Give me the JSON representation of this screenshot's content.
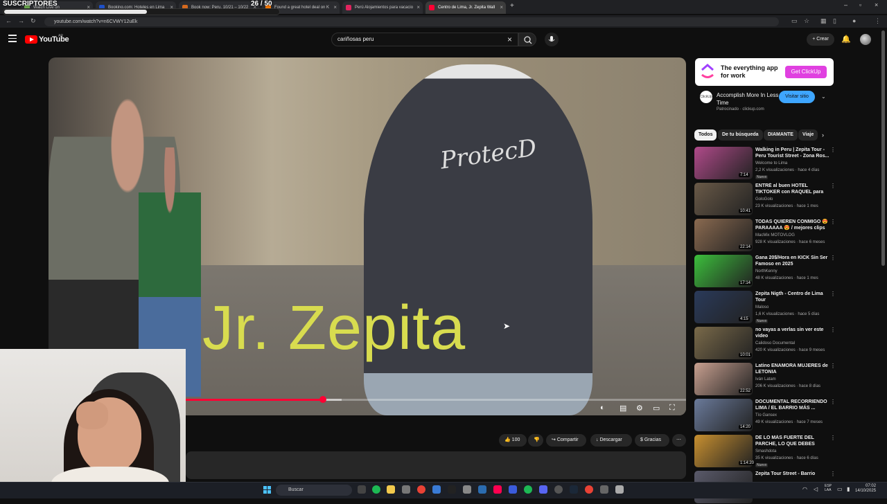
{
  "overlay": {
    "title": "SUSCRIPTORES",
    "count": "26 / 50",
    "progress_fraction": 0.52
  },
  "browser": {
    "tabs": [
      {
        "label": "Watch Live on",
        "color": "#6aa84f"
      },
      {
        "label": "Booking.com: Hoteles en Lima",
        "color": "#1e50c8"
      },
      {
        "label": "Book now: Peru, 10/21 – 10/22",
        "color": "#d4691e"
      },
      {
        "label": "Found a great hotel deal on K",
        "color": "#ff7a00"
      },
      {
        "label": "Perú Alojamientos para vacacio",
        "color": "#e0245e"
      },
      {
        "label": "Centro de Lima, Jr. Zepita Wall",
        "color": "#ff0033"
      }
    ],
    "url": "youtube.com/watch?v=n6CVWY12uEk"
  },
  "youtube": {
    "logo": "YouTube",
    "region": "AR",
    "search_query": "cariñosas peru",
    "create_label": "Crear"
  },
  "video": {
    "overlay_text": "Jr. Zepita",
    "hoodie_text": "ProtecD",
    "progress_fraction": 0.43,
    "buffered_fraction": 0.46
  },
  "actions": {
    "likes": "100",
    "share": "Compartir",
    "download": "Descargar",
    "thanks": "Gracias"
  },
  "ad": {
    "headline": "The everything app for work",
    "cta_banner": "Get ClickUp",
    "icon_label": "ClickUp",
    "title": "Accomplish More In Less Time",
    "sponsor": "Patrocinado · clickup.com",
    "visit": "Visitar sitio"
  },
  "chips": [
    "Todos",
    "De tu búsqueda",
    "DIAMANTE",
    "Viaje"
  ],
  "recommendations": [
    {
      "title": "Walking in Peru | Zepita Tour - Peru Tourist Street - Zona Ros...",
      "channel": "Welcome to Lima",
      "meta": "2,2 K visualizaciones · hace 4 días",
      "badge": "Nuevo",
      "duration": "7:14",
      "color": "#b04a8a"
    },
    {
      "title": "ENTRÉ al buen HOTEL TIKTOKER con RAQUEL para e...",
      "channel": "GoloGolo",
      "meta": "23 K visualizaciones · hace 1 mes",
      "badge": "",
      "duration": "10:41",
      "color": "#6a5a48"
    },
    {
      "title": "TODAS QUIEREN CONMIGO 😍 PARAAAAA 😍 / mejores clips ...",
      "channel": "MacMix MOTOVLOG",
      "meta": "928 K visualizaciones · hace 6 meses",
      "badge": "",
      "duration": "22:14",
      "color": "#8a6a50"
    },
    {
      "title": "Gana 20$/Hora en KICK Sin Ser Famoso en 2025",
      "channel": "NorthKenny",
      "meta": "48 K visualizaciones · hace 1 mes",
      "badge": "",
      "duration": "17:14",
      "color": "#3cbf3c"
    },
    {
      "title": "Zepita Nigth - Centro de Lima Tour",
      "channel": "Maloso",
      "meta": "1,6 K visualizaciones · hace 5 días",
      "badge": "Nuevo",
      "duration": "4:15",
      "color": "#2a3a5a"
    },
    {
      "title": "no vayas a verlas sin ver este video",
      "channel": "Calidoso Documental",
      "meta": "420 K visualizaciones · hace 9 meses",
      "badge": "",
      "duration": "10:01",
      "color": "#7a6a4a"
    },
    {
      "title": "Latino ENAMORA MUJERES de LETONIA",
      "channel": "Iván Latam",
      "meta": "206 K visualizaciones · hace 8 días",
      "badge": "",
      "duration": "22:52",
      "color": "#c8a090"
    },
    {
      "title": "DOCUMENTAL RECORRIENDO LIMA / EL BARRIO MÁS ...",
      "channel": "Tío Gansex",
      "meta": "49 K visualizaciones · hace 7 meses",
      "badge": "",
      "duration": "14:20",
      "color": "#6a7a9a"
    },
    {
      "title": "DE LO MÁS FUERTE DEL PARCHE, LO QUE DEBES HACE...",
      "channel": "Smashdota",
      "meta": "35 K visualizaciones · hace 6 días",
      "badge": "Nuevo",
      "duration": "1:14:20",
      "color": "#c89030"
    },
    {
      "title": "Zepita Tour Street - Barrio",
      "channel": "",
      "meta": "",
      "badge": "",
      "duration": "",
      "color": "#5a5a6a"
    }
  ],
  "taskbar": {
    "search": "Buscar",
    "lang": "ESP LAA",
    "time": "07:02",
    "date": "14/10/2025"
  }
}
